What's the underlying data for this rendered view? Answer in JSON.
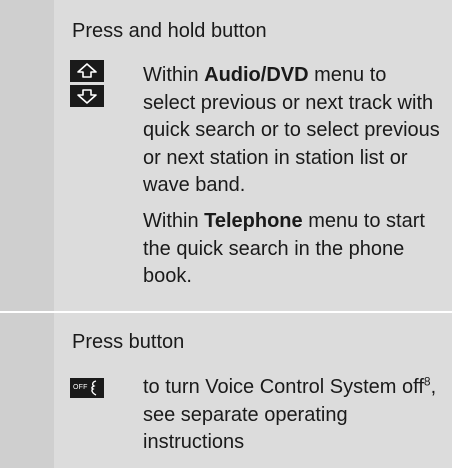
{
  "section1": {
    "heading": "Press and hold button",
    "icons": [
      "up-arrow-button-icon",
      "down-arrow-button-icon"
    ],
    "para1": {
      "prefix": "Within ",
      "bold": "Audio/DVD",
      "suffix": " menu to select previous or next track with quick search or to select previous or next station in station list or wave band."
    },
    "para2": {
      "prefix": "Within ",
      "bold": "Telephone",
      "suffix": " menu to start the quick search in the phone book."
    }
  },
  "section2": {
    "heading": "Press button",
    "icon": "voice-control-off-button-icon",
    "icon_label": "OFF",
    "text_before": "to turn Voice Control System off",
    "footnote": "8",
    "text_after": ", see separate operating instructions"
  },
  "colors": {
    "panel": "#dcdcdc",
    "left_column": "#cfcfcf",
    "divider": "#ffffff",
    "button": "#1a1a1a"
  }
}
